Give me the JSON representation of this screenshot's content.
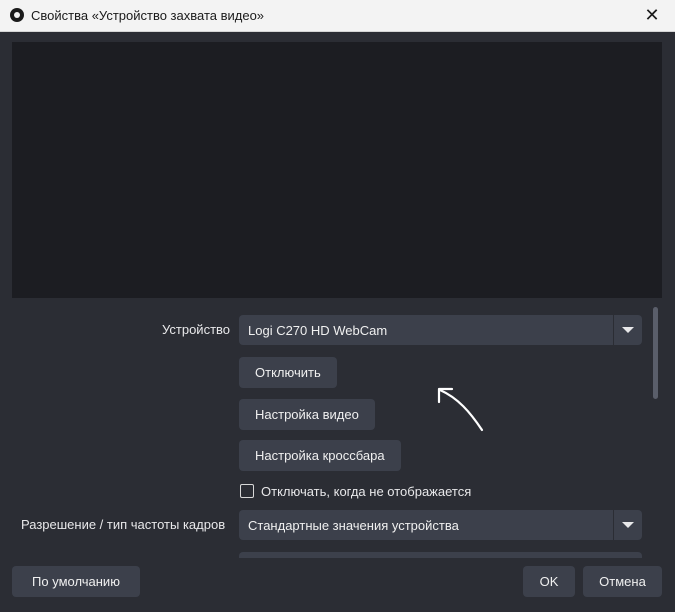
{
  "window": {
    "title": "Свойства «Устройство захвата видео»",
    "app_icon": "obs-icon",
    "close_glyph": "✕"
  },
  "device": {
    "label": "Устройство",
    "value": "Logi C270 HD WebCam"
  },
  "buttons": {
    "disable": "Отключить",
    "video_settings": "Настройка видео",
    "crossbar_settings": "Настройка кроссбара",
    "defaults": "По умолчанию",
    "ok": "OK",
    "cancel": "Отмена"
  },
  "checkbox": {
    "label": "Отключать, когда не отображается",
    "checked": false
  },
  "resolution": {
    "label": "Разрешение / тип частоты кадров",
    "value": "Стандартные значения устройства"
  },
  "extra_select": {
    "value": ""
  },
  "colors": {
    "background": "#2b2d34",
    "preview": "#1c1d22",
    "control": "#3c404b",
    "titlebar": "#f3f3f3"
  }
}
